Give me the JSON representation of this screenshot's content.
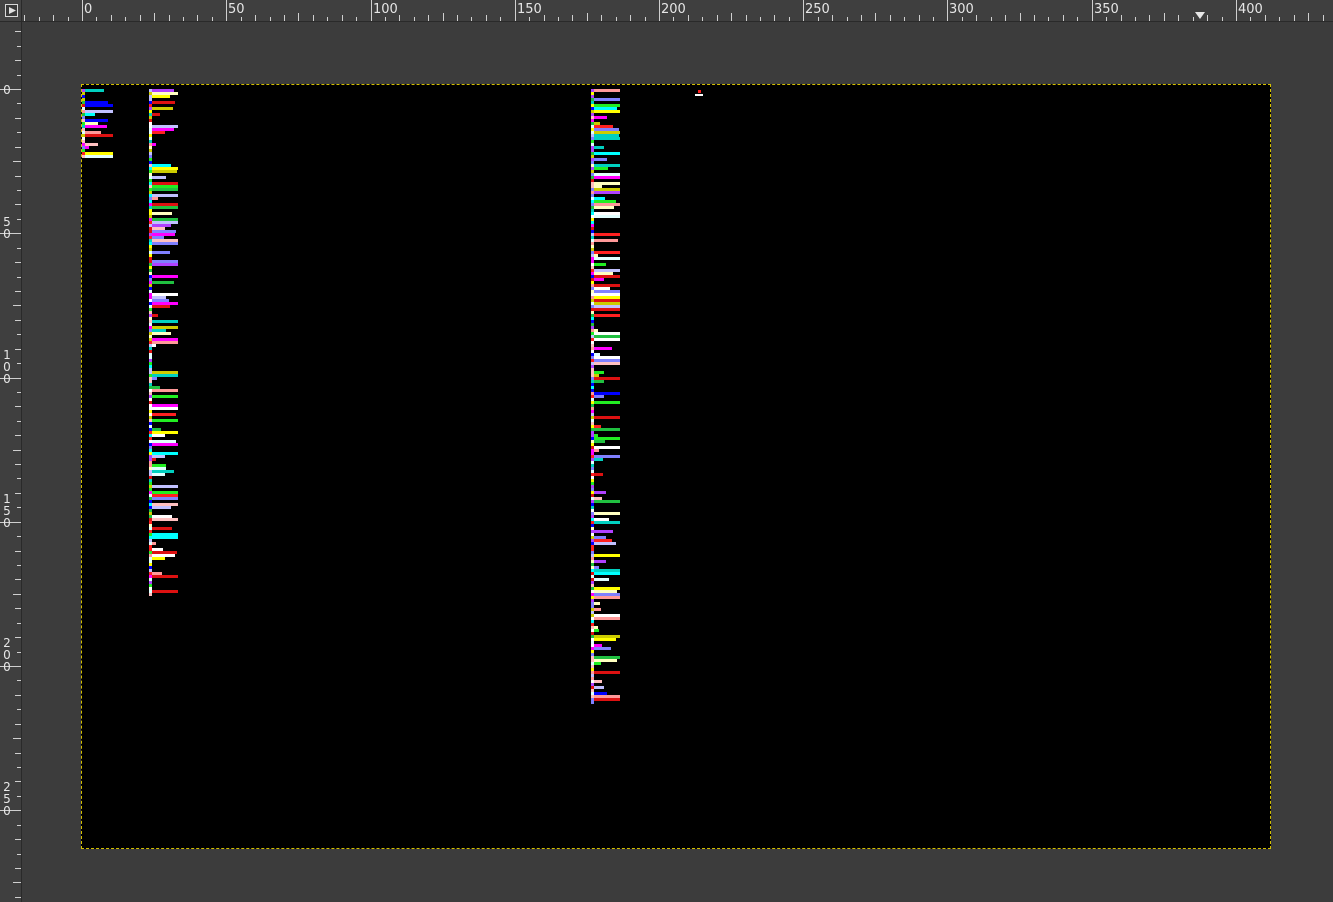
{
  "rulers": {
    "horizontal_labels": [
      "0",
      "50",
      "100",
      "150",
      "200",
      "250",
      "300",
      "350",
      "400"
    ],
    "vertical_labels": [
      "0",
      "50",
      "100",
      "150",
      "200",
      "250"
    ]
  },
  "colors": {
    "workspace": "#3c3c3c",
    "canvas": "#000000",
    "selection_border": "#d4c000"
  },
  "icons": {
    "corner": "quick-mask-toggle-icon",
    "pointer": "pointer-position-marker-icon"
  },
  "image": {
    "description_free": true,
    "palette": [
      "#ff2020",
      "#ffffff",
      "#22ee22",
      "#0000ff",
      "#ff00ff",
      "#ffff00",
      "#00ffff",
      "#ffc0c0",
      "#c0c0ff",
      "#ffffc0",
      "#dd1111",
      "#b040ff",
      "#cccc00",
      "#20c040",
      "#e0ffff",
      "#ff9999",
      "#8080ff",
      "#00d0c0"
    ]
  }
}
